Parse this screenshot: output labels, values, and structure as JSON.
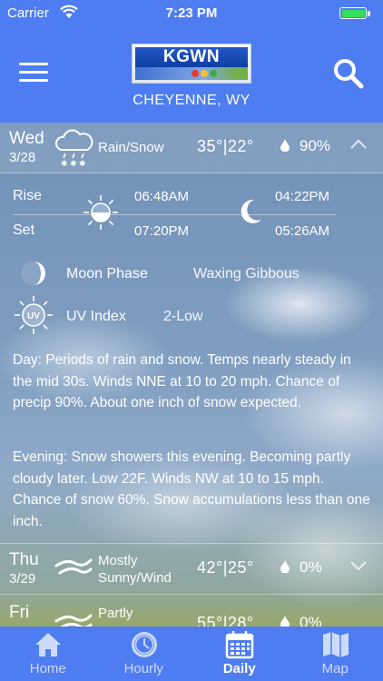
{
  "status_bar": {
    "carrier": "Carrier",
    "time": "7:23 PM"
  },
  "header": {
    "logo_text": "KGWN",
    "city": "CHEYENNE, WY"
  },
  "days": [
    {
      "day": "Wed",
      "date": "3/28",
      "condition": "Rain/Snow",
      "temps": "35°|22°",
      "precip": "90%",
      "icon": "rain-snow-icon",
      "expanded": true
    },
    {
      "day": "Thu",
      "date": "3/29",
      "condition_line1": "Mostly",
      "condition_line2": "Sunny/Wind",
      "temps": "42°|25°",
      "precip": "0%",
      "icon": "wind-icon"
    },
    {
      "day": "Fri",
      "condition_line1": "Partly",
      "temps": "55°|28°",
      "precip": "0%",
      "icon": "wind-icon"
    }
  ],
  "details": {
    "rise_label": "Rise",
    "set_label": "Set",
    "sunrise": "06:48AM",
    "sunset": "07:20PM",
    "moonrise": "04:22PM",
    "moonset": "05:26AM",
    "moon_phase_label": "Moon Phase",
    "moon_phase_value": "Waxing Gibbous",
    "uv_label": "UV Index",
    "uv_value": "2-Low",
    "uv_badge": "UV",
    "day_label": "Day",
    "day_text": ": Periods of rain and snow. Temps nearly steady in the mid 30s. Winds NNE at 10 to 20 mph. Chance of precip 90%. About one inch of snow expected.",
    "evening_label": "Evening",
    "evening_text": ": Snow showers this evening. Becoming partly cloudy later. Low 22F. Winds NW at 10 to 15 mph. Chance of snow 60%. Snow accumulations less than one inch."
  },
  "tabs": [
    {
      "label": "Home",
      "icon": "home-icon"
    },
    {
      "label": "Hourly",
      "icon": "clock-icon"
    },
    {
      "label": "Daily",
      "icon": "calendar-icon",
      "active": true
    },
    {
      "label": "Map",
      "icon": "map-icon"
    }
  ],
  "colors": {
    "header_blue": "#4e7df1",
    "battery_green": "#33e05d"
  }
}
